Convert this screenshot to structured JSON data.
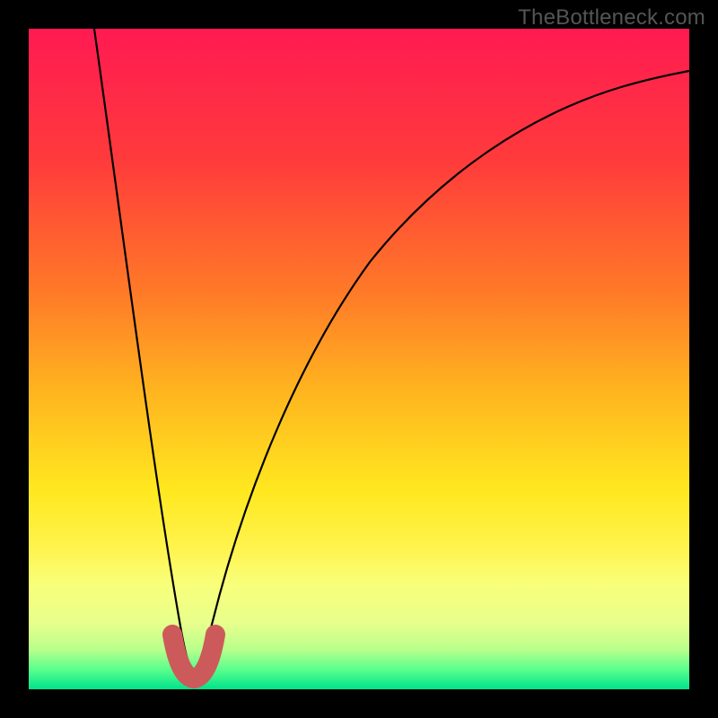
{
  "watermark": "TheBottleneck.com",
  "chart_data": {
    "type": "line",
    "title": "",
    "xlabel": "",
    "ylabel": "",
    "xlim": [
      0,
      100
    ],
    "ylim": [
      0,
      100
    ],
    "grid": false,
    "legend": false,
    "background": {
      "type": "vertical-gradient",
      "stops": [
        {
          "y": 0,
          "color": "#ff1a52"
        },
        {
          "y": 20,
          "color": "#ff3b3b"
        },
        {
          "y": 40,
          "color": "#ff7a28"
        },
        {
          "y": 55,
          "color": "#ffb51f"
        },
        {
          "y": 70,
          "color": "#ffe81f"
        },
        {
          "y": 79,
          "color": "#fff450"
        },
        {
          "y": 84,
          "color": "#f9ff7a"
        },
        {
          "y": 90,
          "color": "#e8ff8c"
        },
        {
          "y": 94,
          "color": "#b9ff8c"
        },
        {
          "y": 97,
          "color": "#5aff8c"
        },
        {
          "y": 100,
          "color": "#00e38c"
        }
      ]
    },
    "series": [
      {
        "name": "bottleneck-curve",
        "color": "#000000",
        "width": 2,
        "x": [
          10,
          12,
          14,
          16,
          18,
          20,
          22,
          23.5,
          25,
          26.5,
          28,
          30,
          33,
          36,
          40,
          45,
          50,
          55,
          60,
          65,
          70,
          75,
          80,
          85,
          90,
          95,
          100
        ],
        "y": [
          100,
          88,
          76,
          64,
          52,
          40,
          24,
          10,
          3,
          10,
          24,
          37,
          48,
          56,
          63,
          69,
          74,
          77.5,
          80.5,
          83,
          85,
          86.8,
          88.3,
          89.5,
          90.5,
          91.3,
          92
        ]
      },
      {
        "name": "optimal-marker",
        "color": "#cc5a5a",
        "width": 12,
        "x": [
          22.3,
          23.0,
          23.8,
          25.0,
          26.2,
          27.0,
          27.7
        ],
        "y": [
          8.5,
          4.0,
          1.5,
          1.0,
          1.5,
          4.0,
          8.5
        ]
      }
    ],
    "optimal_x": 25
  }
}
